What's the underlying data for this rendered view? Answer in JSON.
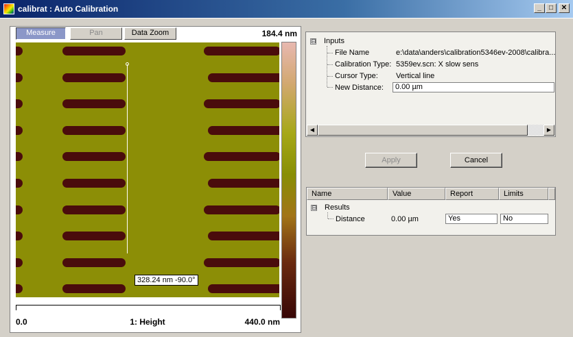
{
  "window": {
    "title": "calibrat : Auto Calibration",
    "min_label": "_",
    "max_label": "□",
    "close_label": "✕"
  },
  "plot": {
    "toolbar": {
      "measure": "Measure",
      "pan": "Pan",
      "data_zoom": "Data Zoom"
    },
    "scale_max": "184.4 nm",
    "x_start": "0.0",
    "channel": "1: Height",
    "x_end": "440.0 nm",
    "cursor_readout": "328.24 nm -90.0°",
    "colors": {
      "background": "#8c8e06",
      "stripe": "#4a0c0c",
      "cursor": "#ffffff"
    }
  },
  "inputs": {
    "expander": "⊟",
    "header": "Inputs",
    "rows": [
      {
        "label": "File Name",
        "value": "e:\\data\\anders\\calibration5346ev-2008\\calibra..."
      },
      {
        "label": "Calibration Type:",
        "value": "5359ev.scn: X slow sens"
      },
      {
        "label": "Cursor Type:",
        "value": "Vertical line"
      },
      {
        "label": "New Distance:",
        "value": "0.00 µm"
      }
    ]
  },
  "scroll": {
    "left_arrow": "◀",
    "right_arrow": "▶"
  },
  "buttons": {
    "apply": "Apply",
    "cancel": "Cancel"
  },
  "results": {
    "columns": {
      "name": "Name",
      "value": "Value",
      "report": "Report",
      "limits": "Limits"
    },
    "expander": "⊟",
    "header": "Results",
    "row": {
      "name": "Distance",
      "value": "0.00 µm",
      "report": "Yes",
      "limits": "No"
    }
  }
}
